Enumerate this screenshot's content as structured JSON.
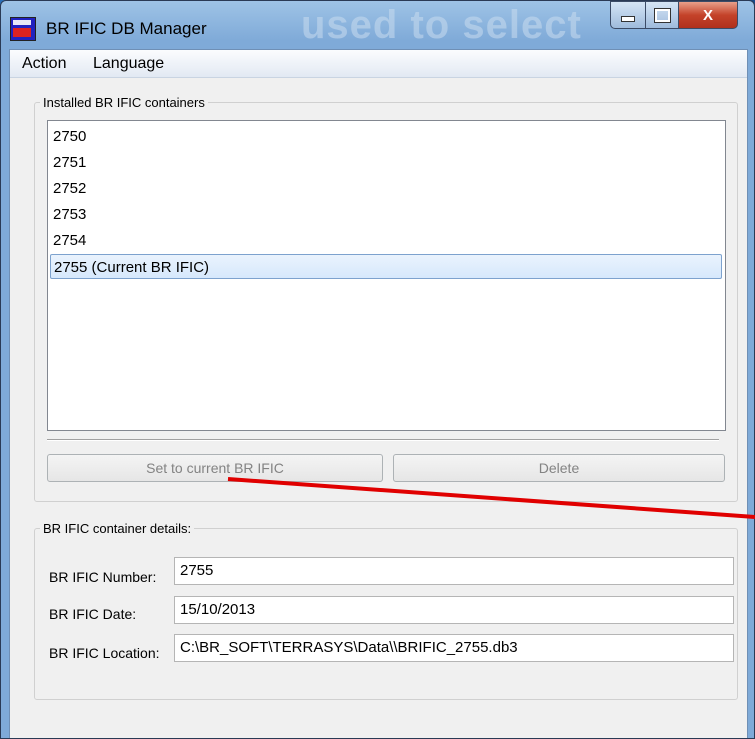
{
  "window": {
    "title": "BR IFIC DB Manager",
    "background_text": "used to select",
    "close_glyph": "X"
  },
  "menu": {
    "items": [
      "Action",
      "Language"
    ]
  },
  "installed": {
    "group_label": "Installed BR IFIC containers",
    "items": [
      "2750",
      "2751",
      "2752",
      "2753",
      "2754",
      "2755 (Current BR IFIC)"
    ],
    "selected_index": 5,
    "set_current_label": "Set to current BR IFIC",
    "delete_label": "Delete"
  },
  "details": {
    "group_label": "BR IFIC container details:",
    "number_label": "BR IFIC Number:",
    "number_value": "2755",
    "date_label": "BR IFIC Date:",
    "date_value": "15/10/2013",
    "location_label": "BR IFIC Location:",
    "location_value": "C:\\BR_SOFT\\TERRASYS\\Data\\\\BRIFIC_2755.db3"
  },
  "colors": {
    "annotation_arrow": "#e00000",
    "selection": "#d6e8fc"
  }
}
